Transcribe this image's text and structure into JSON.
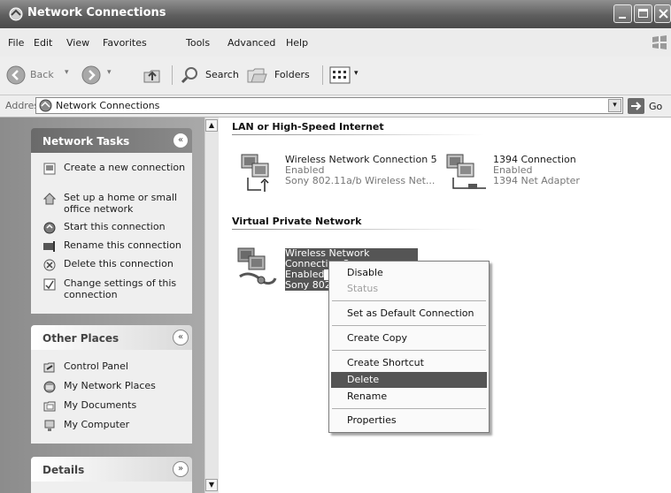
{
  "window": {
    "title": "Network Connections"
  },
  "menubar": {
    "items": [
      "File",
      "Edit",
      "View",
      "Favorites",
      "Tools",
      "Advanced",
      "Help"
    ]
  },
  "toolbar": {
    "back_label": "Back",
    "search_label": "Search",
    "folders_label": "Folders"
  },
  "address": {
    "label": "Address",
    "value": "Network Connections",
    "go_label": "Go"
  },
  "taskpane": {
    "network_tasks": {
      "title": "Network Tasks",
      "items": [
        {
          "label": "Create a new connection",
          "icon": "new-connection-icon"
        },
        {
          "label": "Set up a home or small office network",
          "icon": "home-network-icon"
        },
        {
          "label": "Start this connection",
          "icon": "start-connection-icon"
        },
        {
          "label": "Rename this connection",
          "icon": "rename-icon"
        },
        {
          "label": "Delete this connection",
          "icon": "delete-icon"
        },
        {
          "label": "Change settings of this connection",
          "icon": "settings-icon"
        }
      ]
    },
    "other_places": {
      "title": "Other Places",
      "items": [
        {
          "label": "Control Panel",
          "icon": "control-panel-icon"
        },
        {
          "label": "My Network Places",
          "icon": "network-places-icon"
        },
        {
          "label": "My Documents",
          "icon": "documents-icon"
        },
        {
          "label": "My Computer",
          "icon": "computer-icon"
        }
      ]
    },
    "details": {
      "title": "Details"
    }
  },
  "content": {
    "groups": [
      {
        "title": "LAN or High-Speed Internet",
        "connections": [
          {
            "name": "Wireless Network Connection 5",
            "status": "Enabled",
            "device": "Sony 802.11a/b Wireless Net..."
          },
          {
            "name": "1394 Connection",
            "status": "Enabled",
            "device": "1394 Net Adapter"
          }
        ]
      },
      {
        "title": "Virtual Private Network",
        "connections": [
          {
            "name": "Wireless Network Connection 3",
            "status": "Enabled",
            "device": "Sony 802"
          }
        ]
      }
    ]
  },
  "context_menu": {
    "items": [
      "Disable",
      "Status",
      "Set as Default Connection",
      "Create Copy",
      "Create Shortcut",
      "Delete",
      "Rename",
      "Properties"
    ],
    "selected": "Delete",
    "disabled": [
      "Status"
    ]
  },
  "colors": {
    "selection": "#555555",
    "pane_gradient_start": "#8c8c8c",
    "titlebar": "#5e5e5e"
  }
}
